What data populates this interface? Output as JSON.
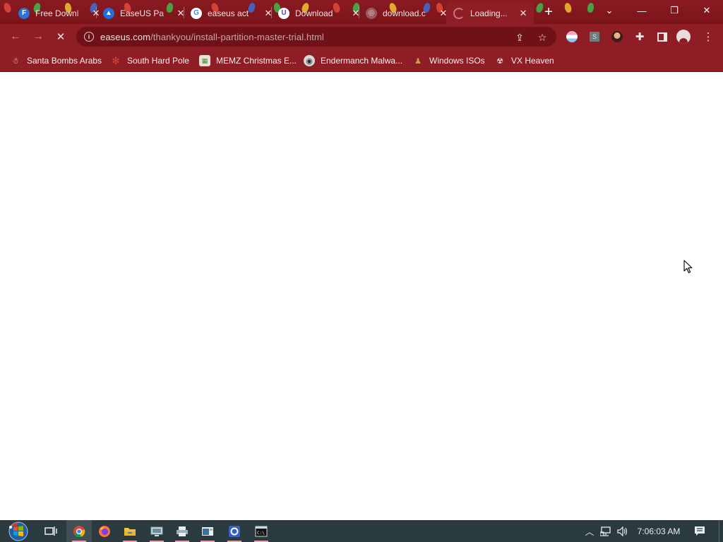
{
  "browser": {
    "tabs": [
      {
        "title": "Free Downl",
        "favicon": "firefox-like-icon",
        "active": false
      },
      {
        "title": "EaseUS Pa",
        "favicon": "easeus-icon",
        "active": false
      },
      {
        "title": "easeus act",
        "favicon": "google-icon",
        "active": false
      },
      {
        "title": "Download",
        "favicon": "u-icon",
        "active": false
      },
      {
        "title": "download.c",
        "favicon": "globe-icon",
        "active": false
      },
      {
        "title": "Loading...",
        "favicon": "loading-icon",
        "active": true
      }
    ],
    "new_tab_label": "+",
    "window_controls": {
      "tab_search": "⌄",
      "minimize": "—",
      "restore": "❐",
      "close": "✕"
    },
    "address_bar": {
      "domain": "easeus.com",
      "path": "/thankyou/install-partition-master-trial.html"
    },
    "bookmarks": [
      {
        "label": "Santa Bombs Arabs",
        "icon": "santa-icon"
      },
      {
        "label": "South Hard Pole",
        "icon": "snowflake-icon"
      },
      {
        "label": "MEMZ Christmas E...",
        "icon": "memz-icon"
      },
      {
        "label": "Endermanch Malwa...",
        "icon": "raccoon-icon"
      },
      {
        "label": "Windows ISOs",
        "icon": "windows-iso-icon"
      },
      {
        "label": "VX Heaven",
        "icon": "vx-heaven-icon"
      }
    ]
  },
  "taskbar": {
    "clock": "7:06:03 AM",
    "apps": [
      "start-button",
      "task-view",
      "chrome",
      "firefox",
      "file-explorer",
      "app-5",
      "app-6",
      "app-7",
      "app-8",
      "cmd"
    ]
  },
  "colors": {
    "chrome_theme": "#8f1d25",
    "tabstrip": "#7a1419",
    "taskbar": "#2b3a3f"
  }
}
